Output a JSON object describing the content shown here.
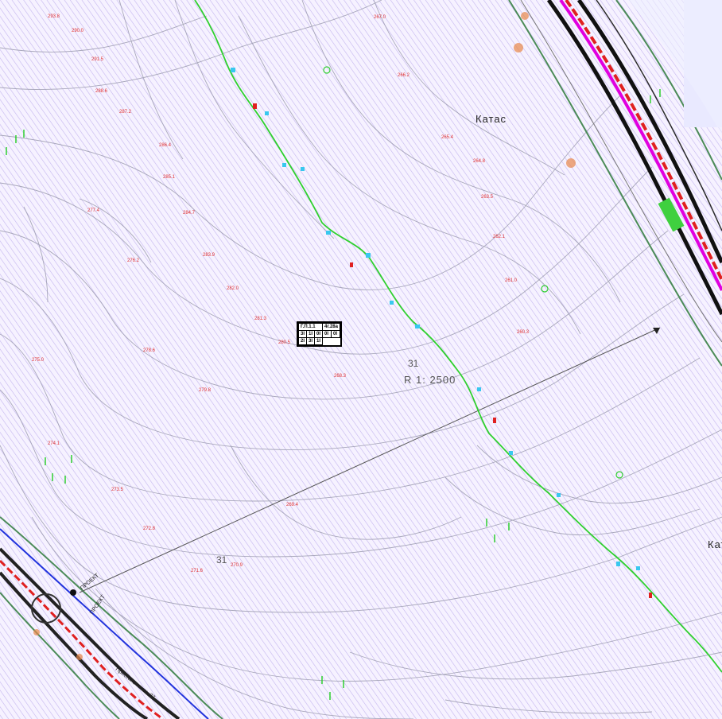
{
  "map": {
    "settlement_labels": [
      "Катас",
      "Кат"
    ],
    "parcel_labels": [
      "31",
      "31"
    ],
    "scale_label": "R 1: 2500",
    "block": {
      "code": "Г.П.1.1",
      "area": "4г.28а",
      "row1": [
        "3I",
        "1I",
        "0I",
        "0I",
        "0I"
      ],
      "row2": [
        "2I",
        "3I",
        "1I"
      ]
    },
    "road_signs": [
      "ПРОЕКТ",
      "ПРОЕКТ",
      "Пристань нижн. 27"
    ],
    "elevations": [
      "293.8",
      "290.0",
      "291.5",
      "288.6",
      "287.2",
      "286.4",
      "285.1",
      "284.7",
      "283.9",
      "282.0",
      "281.3",
      "280.5",
      "279.8",
      "278.6",
      "277.4",
      "276.2",
      "275.0",
      "274.1",
      "273.5",
      "272.8",
      "271.6",
      "270.9",
      "269.4",
      "268.3",
      "267.0",
      "266.2",
      "265.4",
      "264.8",
      "263.5",
      "262.1",
      "261.0",
      "260.3"
    ]
  },
  "colors": {
    "hatch": "#b8a6ea",
    "contour": "#9a9aa8",
    "creek": "#2fd02f",
    "road_edge": "#4b8b58",
    "road_red": "#e02020",
    "road_magenta": "#e000e0",
    "elev_text": "#e03030"
  }
}
